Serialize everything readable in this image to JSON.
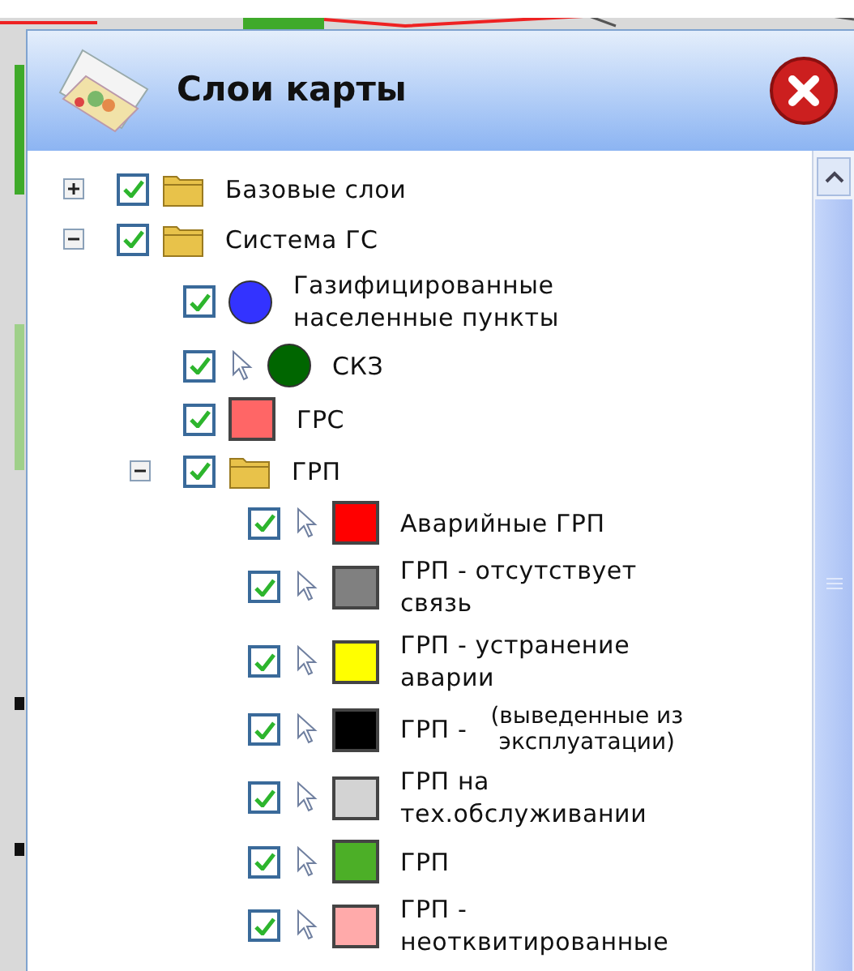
{
  "panel": {
    "title": "Слои карты"
  },
  "tree": [
    {
      "kind": "folder",
      "label": "Базовые слои",
      "checked": true,
      "expanded": false
    },
    {
      "kind": "folder",
      "label": "Система ГС",
      "checked": true,
      "expanded": true,
      "children": [
        {
          "kind": "circle",
          "label": "Газифицированные населенные пункты",
          "checked": true,
          "selectable": false,
          "color": "#3333ff"
        },
        {
          "kind": "circle",
          "label": "СКЗ",
          "checked": true,
          "selectable": true,
          "color": "#006600"
        },
        {
          "kind": "square",
          "label": "ГРС",
          "checked": true,
          "selectable": false,
          "color": "#ff6666"
        },
        {
          "kind": "folder",
          "label": "ГРП",
          "checked": true,
          "expanded": true,
          "children": [
            {
              "kind": "square",
              "label": "Аварийные ГРП",
              "checked": true,
              "selectable": true,
              "color": "#ff0000"
            },
            {
              "kind": "square",
              "label": "ГРП - отсутствует связь",
              "checked": true,
              "selectable": true,
              "color": "#808080"
            },
            {
              "kind": "square",
              "label": "ГРП - устранение аварии",
              "checked": true,
              "selectable": true,
              "color": "#ffff00"
            },
            {
              "kind": "square",
              "label": "ГРП -",
              "note": "(выведенные из эксплуатации)",
              "checked": true,
              "selectable": true,
              "color": "#000000"
            },
            {
              "kind": "square",
              "label": "ГРП на тех.обслуживании",
              "checked": true,
              "selectable": true,
              "color": "#d3d3d3"
            },
            {
              "kind": "square",
              "label": "ГРП",
              "checked": true,
              "selectable": true,
              "color": "#4caf27"
            },
            {
              "kind": "square",
              "label": "ГРП - неотквитированные",
              "checked": true,
              "selectable": true,
              "color": "#ffaaaa"
            }
          ]
        }
      ]
    }
  ]
}
